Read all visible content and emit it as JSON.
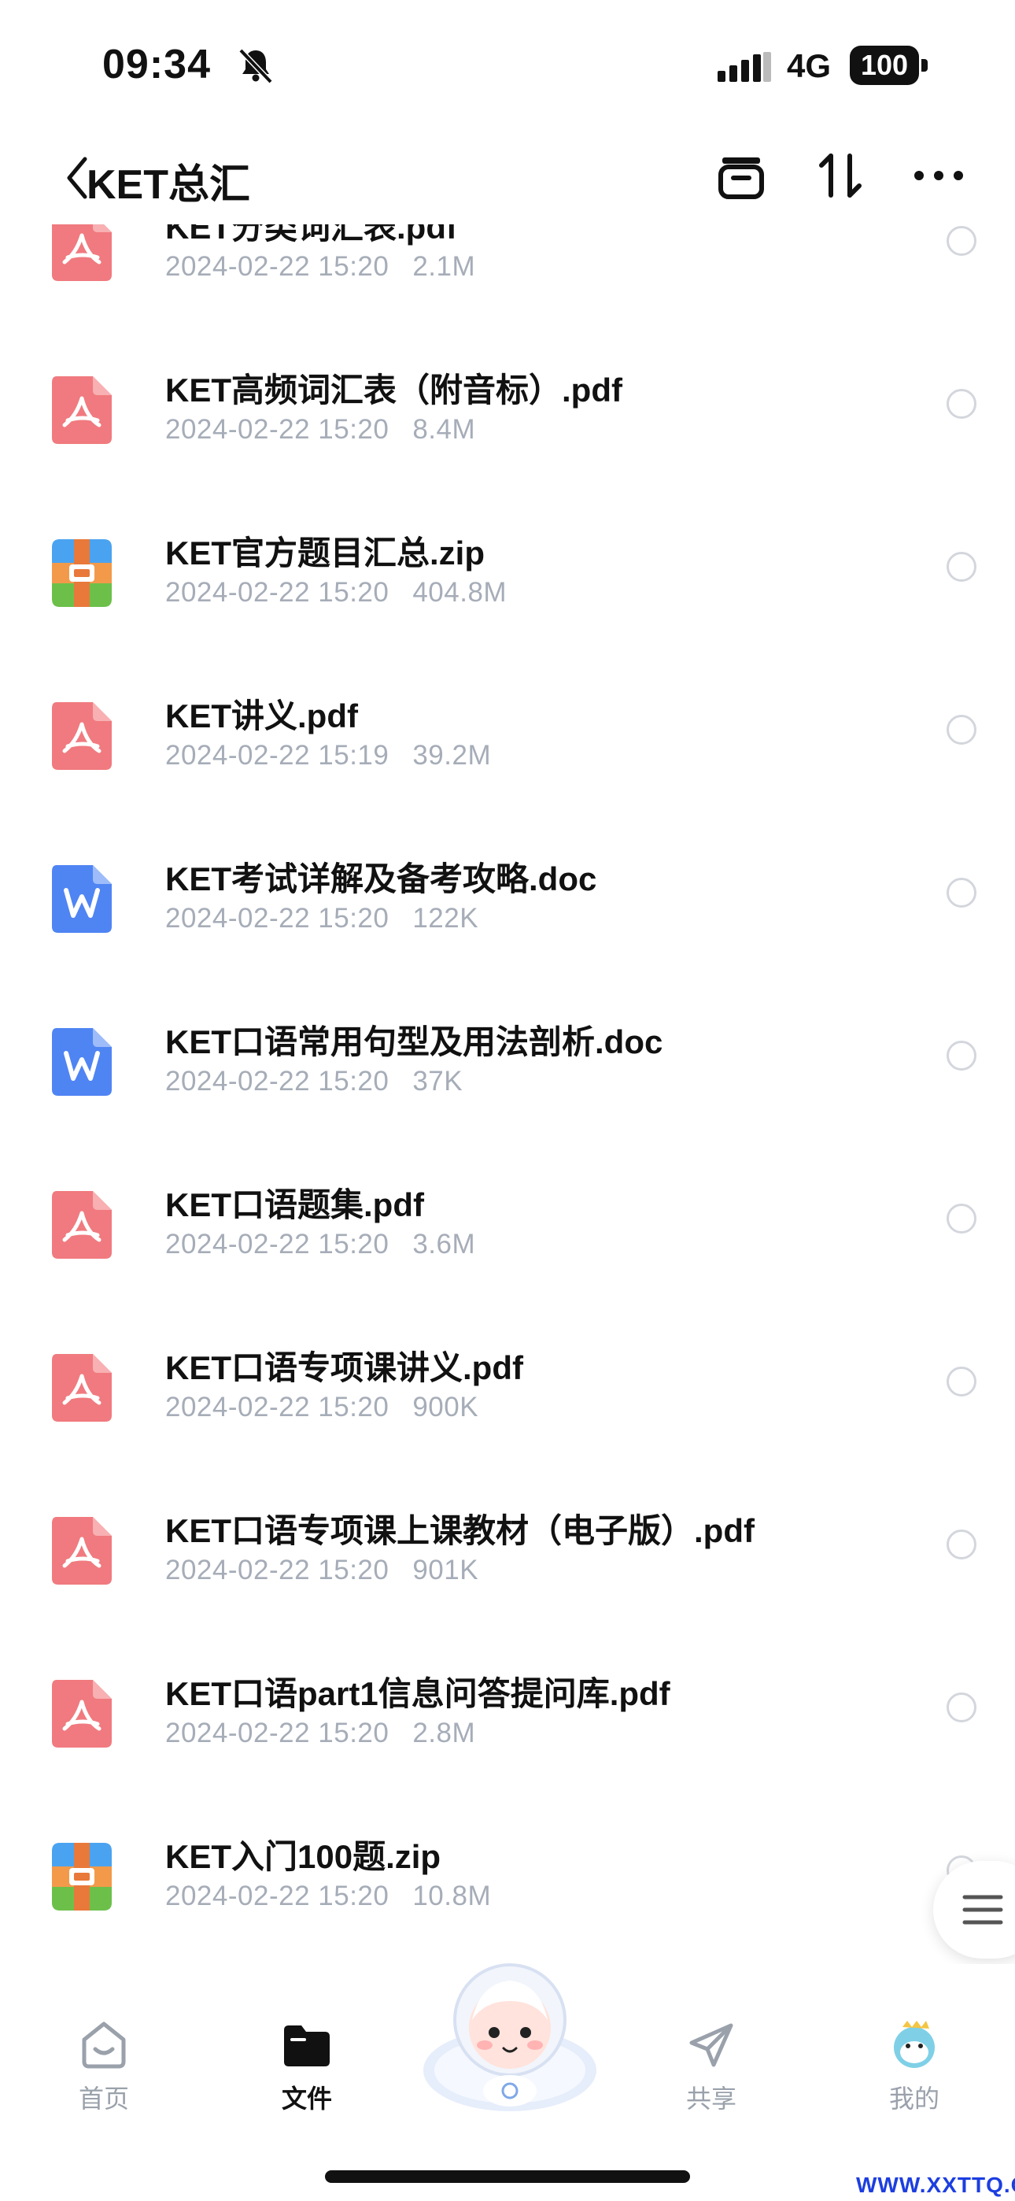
{
  "status": {
    "time": "09:34",
    "network": "4G",
    "battery": "100"
  },
  "nav": {
    "title": "KET总汇"
  },
  "files": [
    {
      "name": "KET分类词汇表.pdf",
      "date": "2024-02-22 15:20",
      "size": "2.1M",
      "type": "pdf"
    },
    {
      "name": "KET高频词汇表（附音标）.pdf",
      "date": "2024-02-22 15:20",
      "size": "8.4M",
      "type": "pdf"
    },
    {
      "name": "KET官方题目汇总.zip",
      "date": "2024-02-22 15:20",
      "size": "404.8M",
      "type": "zip"
    },
    {
      "name": "KET讲义.pdf",
      "date": "2024-02-22 15:19",
      "size": "39.2M",
      "type": "pdf"
    },
    {
      "name": "KET考试详解及备考攻略.doc",
      "date": "2024-02-22 15:20",
      "size": "122K",
      "type": "doc"
    },
    {
      "name": "KET口语常用句型及用法剖析.doc",
      "date": "2024-02-22 15:20",
      "size": "37K",
      "type": "doc"
    },
    {
      "name": "KET口语题集.pdf",
      "date": "2024-02-22 15:20",
      "size": "3.6M",
      "type": "pdf"
    },
    {
      "name": "KET口语专项课讲义.pdf",
      "date": "2024-02-22 15:20",
      "size": "900K",
      "type": "pdf"
    },
    {
      "name": "KET口语专项课上课教材（电子版）.pdf",
      "date": "2024-02-22 15:20",
      "size": "901K",
      "type": "pdf"
    },
    {
      "name": "KET口语part1信息问答提问库.pdf",
      "date": "2024-02-22 15:20",
      "size": "2.8M",
      "type": "pdf"
    },
    {
      "name": "KET入门100题.zip",
      "date": "2024-02-22 15:20",
      "size": "10.8M",
      "type": "zip"
    }
  ],
  "tabs": [
    {
      "label": "首页",
      "icon": "home-icon"
    },
    {
      "label": "文件",
      "icon": "folder-icon"
    },
    {
      "label": "共享",
      "icon": "send-icon"
    },
    {
      "label": "我的",
      "icon": "avatar-icon"
    }
  ],
  "watermark": "WWW.XXTTQ.COM",
  "colors": {
    "pdf": "#f07a7f",
    "doc": "#4f84f3",
    "meta": "#a6adb8",
    "active_tab": "#111111",
    "inactive_tab": "#9aa1ab"
  }
}
